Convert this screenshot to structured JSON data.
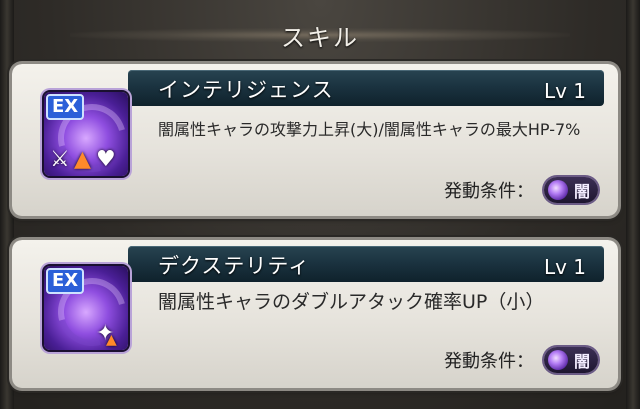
{
  "header": {
    "title": "スキル"
  },
  "skills": [
    {
      "badge": "EX",
      "name": "インテリジェンス",
      "level": "Lv 1",
      "description": "闇属性キャラの攻撃力上昇(大)/闇属性キャラの最大HP-7%",
      "condition_label": "発動条件：",
      "condition_value": "闇",
      "icon": "dark-skill-icon"
    },
    {
      "badge": "EX",
      "name": "デクステリティ",
      "level": "Lv 1",
      "description": "闇属性キャラのダブルアタック確率UP（小）",
      "condition_label": "発動条件：",
      "condition_value": "闇",
      "icon": "dark-skill-icon"
    }
  ],
  "colors": {
    "card_bar": "#1b3340",
    "accent_dark": "#8f4ee0"
  }
}
